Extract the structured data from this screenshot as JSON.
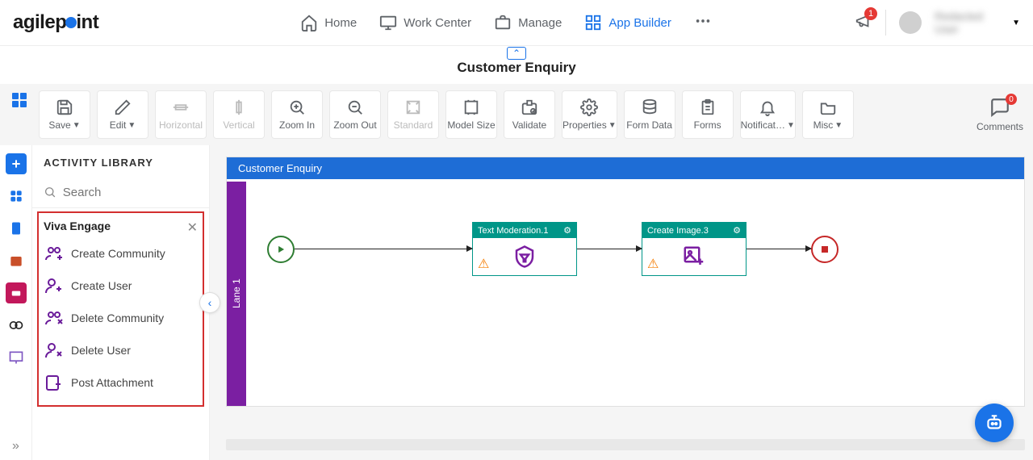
{
  "brand": "agilepoint",
  "nav": {
    "home": "Home",
    "work_center": "Work Center",
    "manage": "Manage",
    "app_builder": "App Builder"
  },
  "notifications_count": "1",
  "user_name": "Redacted User",
  "page": {
    "title": "Customer Enquiry"
  },
  "toolbar": {
    "save": "Save",
    "edit": "Edit",
    "horizontal": "Horizontal",
    "vertical": "Vertical",
    "zoom_in": "Zoom In",
    "zoom_out": "Zoom Out",
    "standard": "Standard",
    "model_size": "Model Size",
    "validate": "Validate",
    "properties": "Properties",
    "form_data": "Form Data",
    "forms": "Forms",
    "notifications": "Notificat…",
    "misc": "Misc",
    "comments": "Comments",
    "comments_count": "0"
  },
  "library": {
    "heading": "ACTIVITY LIBRARY",
    "search_placeholder": "Search",
    "group_title": "Viva Engage",
    "items": [
      "Create Community",
      "Create User",
      "Delete Community",
      "Delete User",
      "Post Attachment"
    ]
  },
  "canvas": {
    "header": "Customer Enquiry",
    "lane": "Lane 1",
    "activities": [
      {
        "title": "Text Moderation.1"
      },
      {
        "title": "Create Image.3"
      }
    ]
  }
}
